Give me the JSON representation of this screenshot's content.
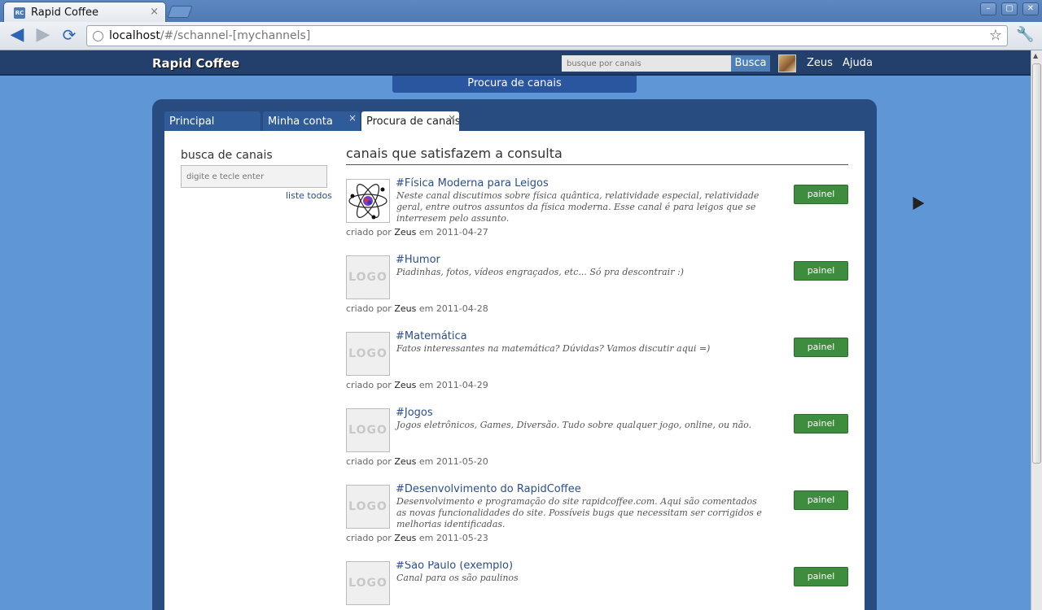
{
  "browser": {
    "tab_title": "Rapid Coffee",
    "tab_close": "×",
    "favicon_text": "RC",
    "url_host": "localhost",
    "url_path": "/#/schannel-[mychannels]"
  },
  "site": {
    "brand": "Rapid Coffee",
    "search_placeholder": "busque por canais",
    "search_button": "Busca",
    "user_name": "Zeus",
    "help_link": "Ajuda",
    "page_label": "Procura de canais"
  },
  "tabs": [
    {
      "label": "Principal"
    },
    {
      "label": "Minha conta",
      "close": "×"
    },
    {
      "label": "Procura de canais",
      "close": "×"
    }
  ],
  "sidebar": {
    "title": "busca de canais",
    "input_placeholder": "digite e tecle enter",
    "list_all": "liste todos"
  },
  "results": {
    "title": "canais que satisfazem a consulta",
    "created_by": "criado por",
    "on": "em",
    "button_label": "painel",
    "logo_placeholder": "LOGO",
    "channels": [
      {
        "name": "#Física Moderna para Leigos",
        "desc": "Neste canal discutimos sobre física quântica, relatividade especial, relatividade geral, entre outros assuntos da física moderna. Esse canal é para leigos que se interresem pelo assunto.",
        "author": "Zeus",
        "date": "2011-04-27"
      },
      {
        "name": "#Humor",
        "desc": "Piadinhas, fotos, vídeos engraçados, etc... Só pra descontrair :)",
        "author": "Zeus",
        "date": "2011-04-28"
      },
      {
        "name": "#Matemática",
        "desc": "Fatos interessantes na matemática? Dúvidas? Vamos discutir aqui =)",
        "author": "Zeus",
        "date": "2011-04-29"
      },
      {
        "name": "#Jogos",
        "desc": "Jogos eletrônicos, Games, Diversão. Tudo sobre qualquer jogo, online, ou não.",
        "author": "Zeus",
        "date": "2011-05-20"
      },
      {
        "name": "#Desenvolvimento do RapidCoffee",
        "desc": "Desenvolvimento e programação do site rapidcoffee.com. Aqui são comentados as novas funcionalidades do site. Possíveis bugs que necessitam ser corrigidos e melhorias identificadas.",
        "author": "Zeus",
        "date": "2011-05-23"
      },
      {
        "name": "#São Paulo (exemplo)",
        "desc": "Canal para os são paulinos",
        "author": "",
        "date": ""
      }
    ]
  }
}
